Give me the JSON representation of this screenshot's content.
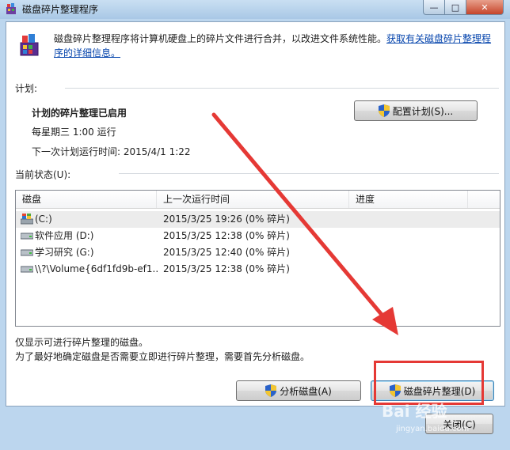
{
  "window": {
    "title": "磁盘碎片整理程序",
    "minimize_glyph": "—",
    "maximize_glyph": "□",
    "close_glyph": "✕"
  },
  "intro": {
    "text": "磁盘碎片整理程序将计算机硬盘上的碎片文件进行合并，以改进文件系统性能。",
    "link": "获取有关磁盘碎片整理程序的详细信息。"
  },
  "schedule": {
    "section_label": "计划:",
    "status": "计划的碎片整理已启用",
    "frequency": "每星期三  1:00 运行",
    "next_run": "下一次计划运行时间: 2015/4/1 1:22",
    "configure_button": "配置计划(S)..."
  },
  "current_status": {
    "section_label": "当前状态(U):",
    "columns": [
      "磁盘",
      "上一次运行时间",
      "进度"
    ],
    "rows": [
      {
        "disk": "(C:)",
        "last_run": "2015/3/25 19:26 (0% 碎片)",
        "progress": "",
        "icon": "system-drive-icon"
      },
      {
        "disk": "软件应用 (D:)",
        "last_run": "2015/3/25 12:38 (0% 碎片)",
        "progress": "",
        "icon": "drive-icon"
      },
      {
        "disk": "学习研究 (G:)",
        "last_run": "2015/3/25 12:40 (0% 碎片)",
        "progress": "",
        "icon": "drive-icon"
      },
      {
        "disk": "\\\\?\\Volume{6df1fd9b-ef1...",
        "last_run": "2015/3/25 12:38 (0% 碎片)",
        "progress": "",
        "icon": "drive-icon"
      }
    ]
  },
  "notes": {
    "line1": "仅显示可进行碎片整理的磁盘。",
    "line2": "为了最好地确定磁盘是否需要立即进行碎片整理，需要首先分析磁盘。"
  },
  "buttons": {
    "analyze": "分析磁盘(A)",
    "defragment": "磁盘碎片整理(D)",
    "close": "关闭(C)"
  },
  "watermark": {
    "text": "Bai 经验",
    "sub": "jingyan.baidu.com"
  },
  "colors": {
    "annotation": "#e53935",
    "link": "#0645ad"
  }
}
